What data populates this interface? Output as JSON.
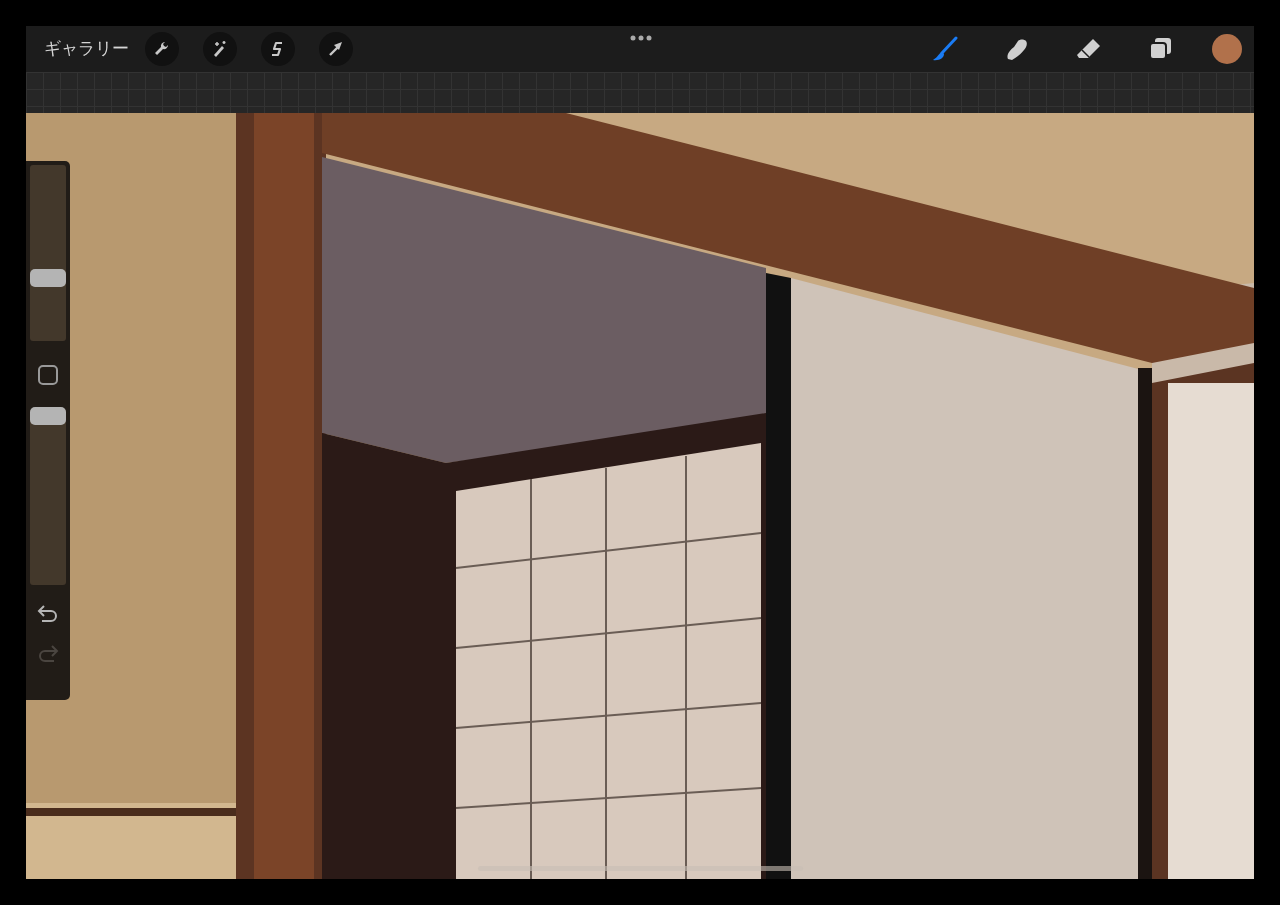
{
  "toolbar": {
    "gallery_label": "ギャラリー",
    "actions": [
      {
        "kind": "wrench"
      },
      {
        "kind": "wand"
      },
      {
        "kind": "selection"
      },
      {
        "kind": "transform"
      }
    ],
    "tools": [
      {
        "kind": "brush",
        "selected": true
      },
      {
        "kind": "smudge",
        "selected": false
      },
      {
        "kind": "eraser",
        "selected": false
      },
      {
        "kind": "layers",
        "selected": false
      }
    ],
    "current_color": {
      "color": "#b1714b"
    }
  },
  "sidebar": {
    "brush_size": {
      "level": 0.36
    },
    "opacity": {
      "level": 0.96
    },
    "undo": {
      "disabled": false
    },
    "redo": {
      "disabled": true
    }
  }
}
